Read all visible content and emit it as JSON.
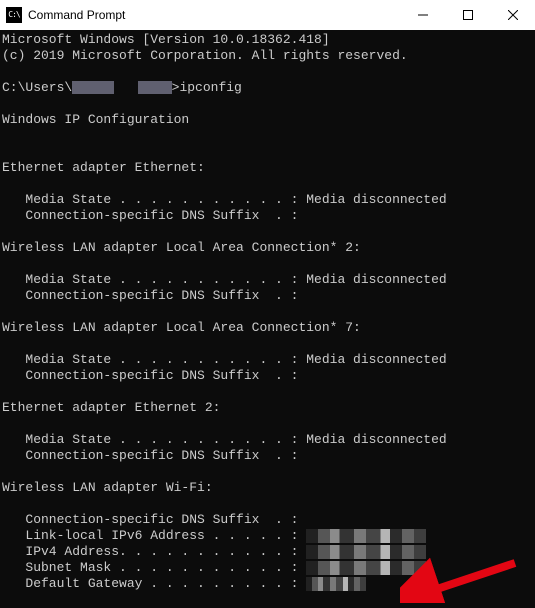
{
  "window": {
    "title": "Command Prompt"
  },
  "header": {
    "line1": "Microsoft Windows [Version 10.0.18362.418]",
    "line2": "(c) 2019 Microsoft Corporation. All rights reserved."
  },
  "prompt": {
    "prefix": "C:\\Users\\",
    "sep": ">",
    "command": "ipconfig"
  },
  "config_title": "Windows IP Configuration",
  "adapters": [
    {
      "name": "Ethernet adapter Ethernet:",
      "media_state_label": "   Media State . . . . . . . . . . . : ",
      "media_state_value": "Media disconnected",
      "dns_suffix_label": "   Connection-specific DNS Suffix  . :"
    },
    {
      "name": "Wireless LAN adapter Local Area Connection* 2:",
      "media_state_label": "   Media State . . . . . . . . . . . : ",
      "media_state_value": "Media disconnected",
      "dns_suffix_label": "   Connection-specific DNS Suffix  . :"
    },
    {
      "name": "Wireless LAN adapter Local Area Connection* 7:",
      "media_state_label": "   Media State . . . . . . . . . . . : ",
      "media_state_value": "Media disconnected",
      "dns_suffix_label": "   Connection-specific DNS Suffix  . :"
    },
    {
      "name": "Ethernet adapter Ethernet 2:",
      "media_state_label": "   Media State . . . . . . . . . . . : ",
      "media_state_value": "Media disconnected",
      "dns_suffix_label": "   Connection-specific DNS Suffix  . :"
    }
  ],
  "wifi": {
    "name": "Wireless LAN adapter Wi-Fi:",
    "dns_suffix_label": "   Connection-specific DNS Suffix  . :",
    "ipv6_label": "   Link-local IPv6 Address . . . . . : ",
    "ipv4_label": "   IPv4 Address. . . . . . . . . . . : ",
    "subnet_label": "   Subnet Mask . . . . . . . . . . . : ",
    "gateway_label": "   Default Gateway . . . . . . . . . : "
  }
}
